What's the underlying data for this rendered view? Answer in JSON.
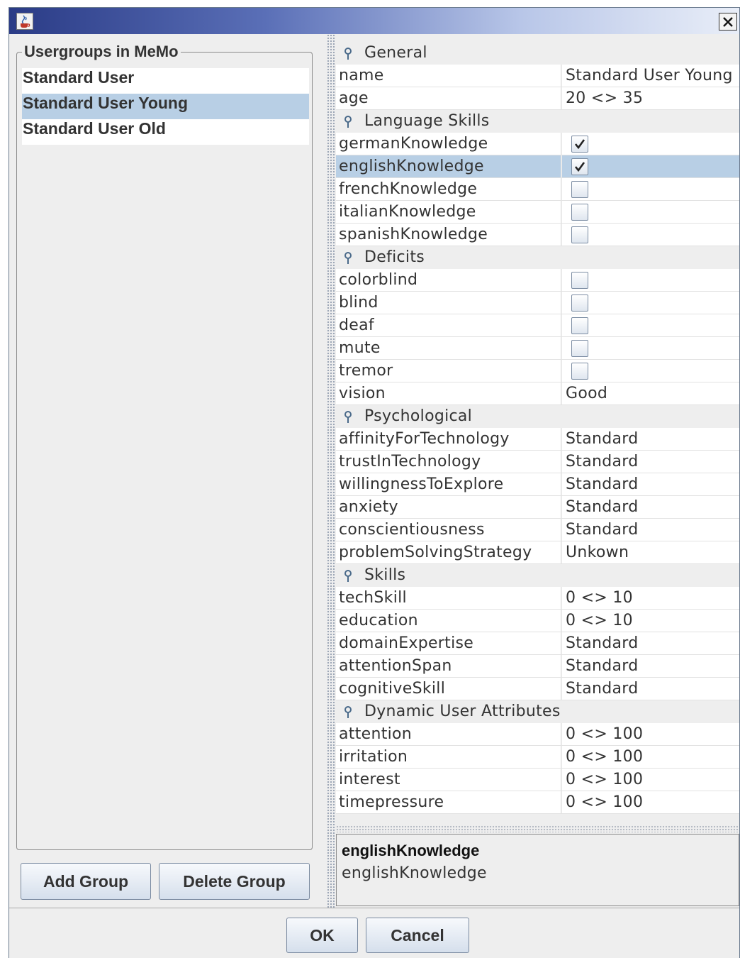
{
  "window": {
    "icon": "java-coffee-icon",
    "close_label": "✕"
  },
  "left": {
    "group_title": "Usergroups in MeMo",
    "items": [
      {
        "label": "Standard User",
        "selected": false
      },
      {
        "label": "Standard User Young",
        "selected": true
      },
      {
        "label": "Standard User Old",
        "selected": false
      }
    ],
    "add_button": "Add Group",
    "delete_button": "Delete Group"
  },
  "properties": [
    {
      "type": "category",
      "label": "General"
    },
    {
      "type": "text",
      "key": "name",
      "value": "Standard User Young"
    },
    {
      "type": "text",
      "key": "age",
      "value": "20 <> 35"
    },
    {
      "type": "category",
      "label": "Language Skills"
    },
    {
      "type": "check",
      "key": "germanKnowledge",
      "checked": true
    },
    {
      "type": "check",
      "key": "englishKnowledge",
      "checked": true,
      "selected": true
    },
    {
      "type": "check",
      "key": "frenchKnowledge",
      "checked": false
    },
    {
      "type": "check",
      "key": "italianKnowledge",
      "checked": false
    },
    {
      "type": "check",
      "key": "spanishKnowledge",
      "checked": false
    },
    {
      "type": "category",
      "label": "Deficits"
    },
    {
      "type": "check",
      "key": "colorblind",
      "checked": false
    },
    {
      "type": "check",
      "key": "blind",
      "checked": false
    },
    {
      "type": "check",
      "key": "deaf",
      "checked": false
    },
    {
      "type": "check",
      "key": "mute",
      "checked": false
    },
    {
      "type": "check",
      "key": "tremor",
      "checked": false
    },
    {
      "type": "text",
      "key": "vision",
      "value": "Good"
    },
    {
      "type": "category",
      "label": "Psychological"
    },
    {
      "type": "text",
      "key": "affinityForTechnology",
      "value": "Standard"
    },
    {
      "type": "text",
      "key": "trustInTechnology",
      "value": "Standard"
    },
    {
      "type": "text",
      "key": "willingnessToExplore",
      "value": "Standard"
    },
    {
      "type": "text",
      "key": "anxiety",
      "value": "Standard"
    },
    {
      "type": "text",
      "key": "conscientiousness",
      "value": "Standard"
    },
    {
      "type": "text",
      "key": "problemSolvingStrategy",
      "value": "Unkown"
    },
    {
      "type": "category",
      "label": "Skills"
    },
    {
      "type": "text",
      "key": "techSkill",
      "value": "0 <> 10"
    },
    {
      "type": "text",
      "key": "education",
      "value": "0 <> 10"
    },
    {
      "type": "text",
      "key": "domainExpertise",
      "value": "Standard"
    },
    {
      "type": "text",
      "key": "attentionSpan",
      "value": "Standard"
    },
    {
      "type": "text",
      "key": "cognitiveSkill",
      "value": "Standard"
    },
    {
      "type": "category",
      "label": "Dynamic User Attributes"
    },
    {
      "type": "text",
      "key": "attention",
      "value": "0 <> 100"
    },
    {
      "type": "text",
      "key": "irritation",
      "value": "0 <> 100"
    },
    {
      "type": "text",
      "key": "interest",
      "value": "0 <> 100"
    },
    {
      "type": "text",
      "key": "timepressure",
      "value": "0 <> 100"
    }
  ],
  "description": {
    "title": "englishKnowledge",
    "text": "englishKnowledge"
  },
  "footer": {
    "ok": "OK",
    "cancel": "Cancel"
  }
}
